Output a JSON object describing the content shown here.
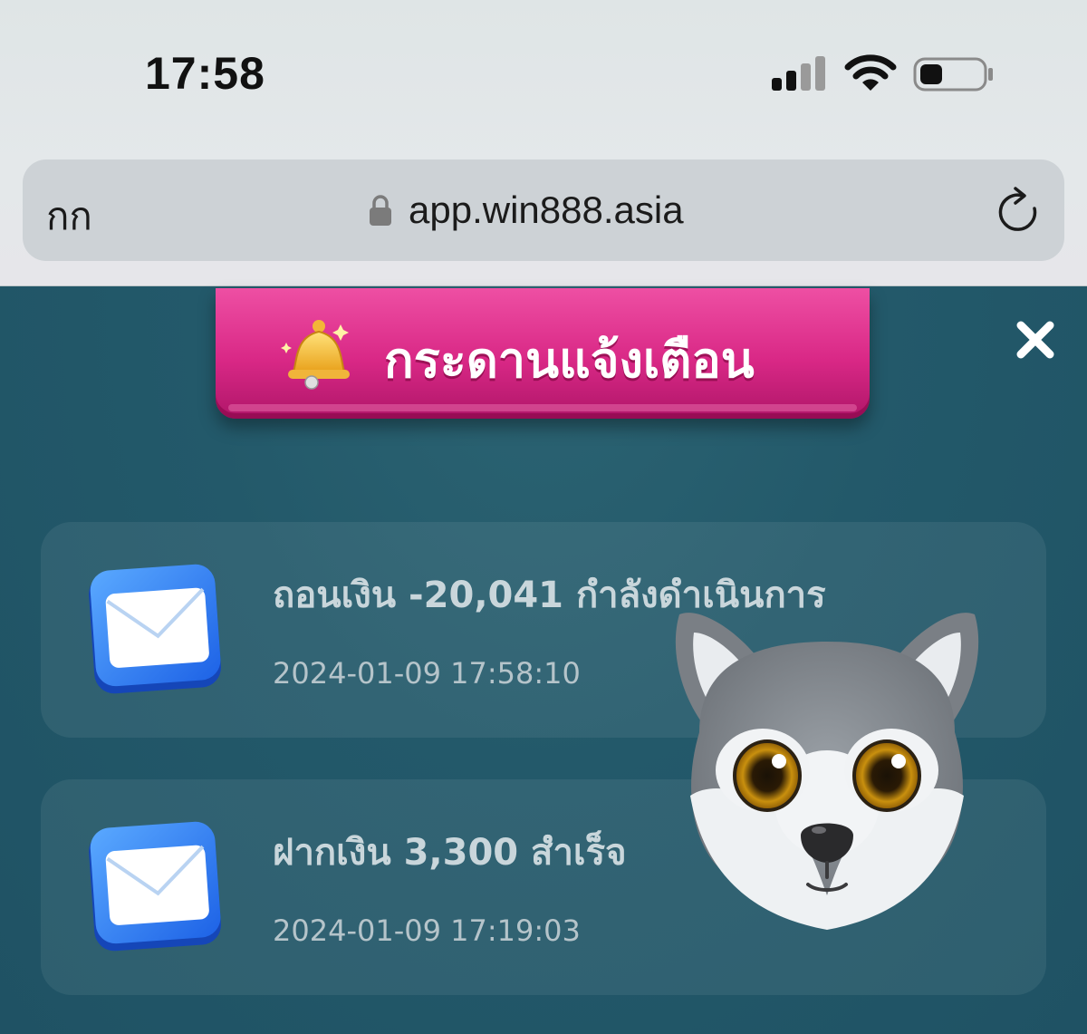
{
  "status_bar": {
    "time": "17:58",
    "icons": [
      "cellular-signal-icon",
      "wifi-icon",
      "battery-icon"
    ]
  },
  "browser": {
    "text_size_button": "กก",
    "url": "app.win888.asia",
    "icons": [
      "lock-icon",
      "reload-icon"
    ]
  },
  "board": {
    "title": "กระดานแจ้งเตือน",
    "icons": [
      "bell-icon",
      "close-icon"
    ],
    "accent_color": "#d92886",
    "background_color": "#23596a"
  },
  "notifications": [
    {
      "title": "ถอนเงิน -20,041 กำลังดำเนินการ",
      "timestamp": "2024-01-09 17:58:10",
      "icon": "envelope-icon"
    },
    {
      "title": "ฝากเงิน 3,300 สำเร็จ",
      "timestamp": "2024-01-09 17:19:03",
      "icon": "envelope-icon"
    }
  ],
  "overlay": {
    "icon": "wolf-mascot"
  }
}
